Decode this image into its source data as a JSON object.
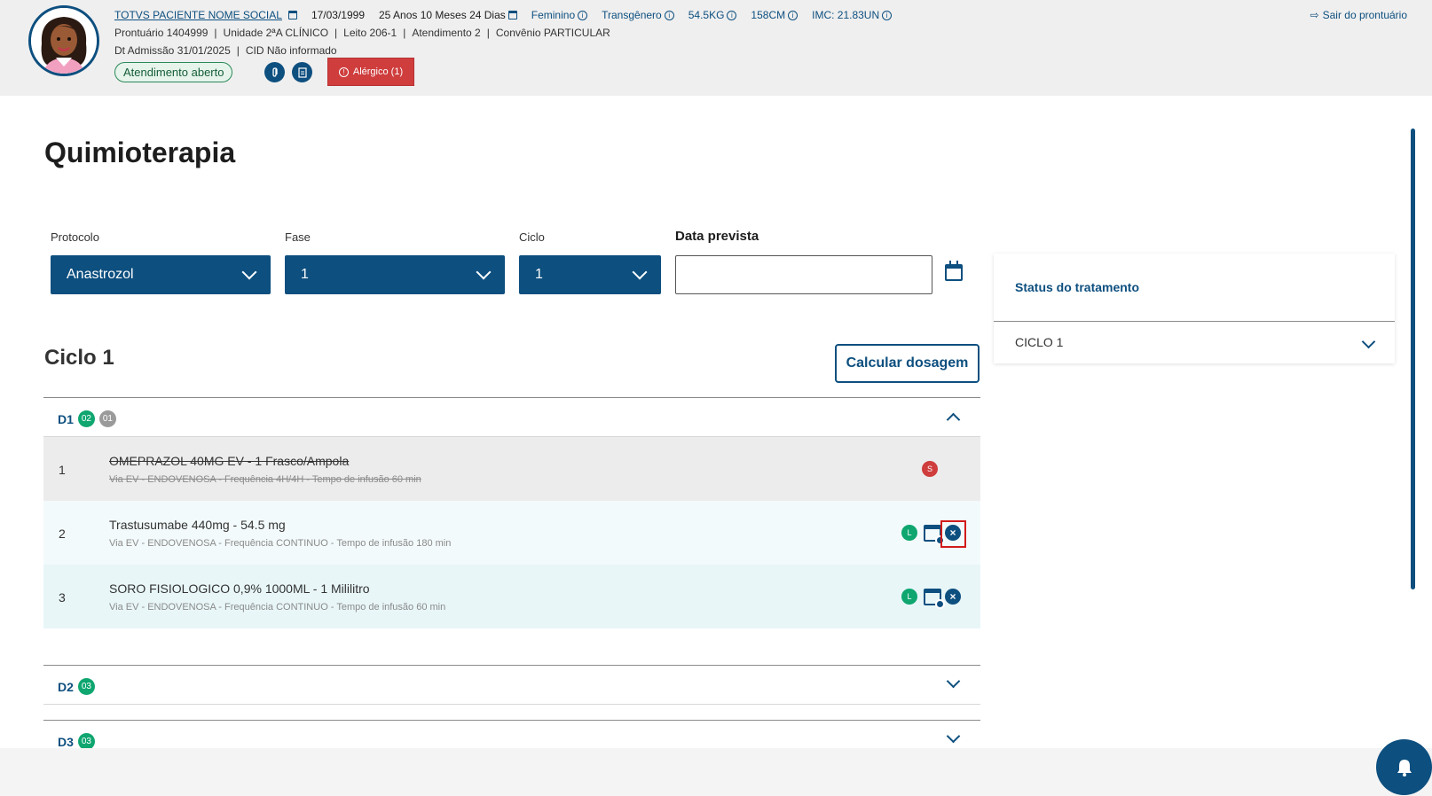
{
  "patient": {
    "name": "TOTVS PACIENTE NOME SOCIAL",
    "birthdate": "17/03/1999",
    "age": "25 Anos 10 Meses 24 Dias",
    "sex": "Feminino",
    "gender": "Transgênero",
    "weight": "54.5KG",
    "height": "158CM",
    "imc": "IMC: 21.83UN",
    "prontuario": "Prontuário 1404999",
    "unidade": "Unidade 2ªA CLÍNICO",
    "leito": "Leito 206-1",
    "atendimento": "Atendimento 2",
    "convenio": "Convênio PARTICULAR",
    "admissao": "Dt Admissão 31/01/2025",
    "cid": "CID Não informado",
    "status": "Atendimento aberto",
    "allergy": "Alérgico (1)"
  },
  "header": {
    "logout": "Sair do prontuário",
    "separator": "|"
  },
  "page": {
    "title": "Quimioterapia"
  },
  "form": {
    "protocolo_label": "Protocolo",
    "protocolo_value": "Anastrozol",
    "fase_label": "Fase",
    "fase_value": "1",
    "ciclo_label": "Ciclo",
    "ciclo_value": "1",
    "data_label": "Data prevista",
    "data_value": ""
  },
  "status_panel": {
    "title": "Status do tratamento",
    "cycle": "CICLO 1"
  },
  "cycle": {
    "title": "Ciclo 1",
    "calc_button": "Calcular dosagem"
  },
  "days": [
    {
      "label": "D1",
      "counts": [
        "02",
        "01"
      ]
    },
    {
      "label": "D2",
      "counts": [
        "03"
      ]
    },
    {
      "label": "D3",
      "counts": [
        "03"
      ]
    }
  ],
  "drugs": [
    {
      "num": "1",
      "name": "OMEPRAZOL 40MG EV - 1 Frasco/Ampola",
      "detail": "Via EV - ENDOVENOSA - Frequência 4H/4H - Tempo de infusão 60 min",
      "tag": "S"
    },
    {
      "num": "2",
      "name": "Trastusumabe 440mg - 54.5 mg",
      "detail": "Via EV - ENDOVENOSA - Frequência CONTINUO - Tempo de infusão 180 min",
      "tag": "L"
    },
    {
      "num": "3",
      "name": "SORO FISIOLOGICO 0,9% 1000ML - 1 Mililitro",
      "detail": "Via EV - ENDOVENOSA - Frequência CONTINUO - Tempo de infusão 60 min",
      "tag": "L"
    }
  ],
  "colors": {
    "primary": "#0d4f7f",
    "danger": "#cf3d3d",
    "success": "#0fa670"
  },
  "icons": [
    "info-icon",
    "calendar-icon",
    "attachment-icon",
    "document-icon",
    "alert-icon",
    "logout-icon",
    "chevron-down-icon",
    "chevron-up-icon",
    "schedule-icon",
    "remove-icon",
    "bell-icon"
  ]
}
